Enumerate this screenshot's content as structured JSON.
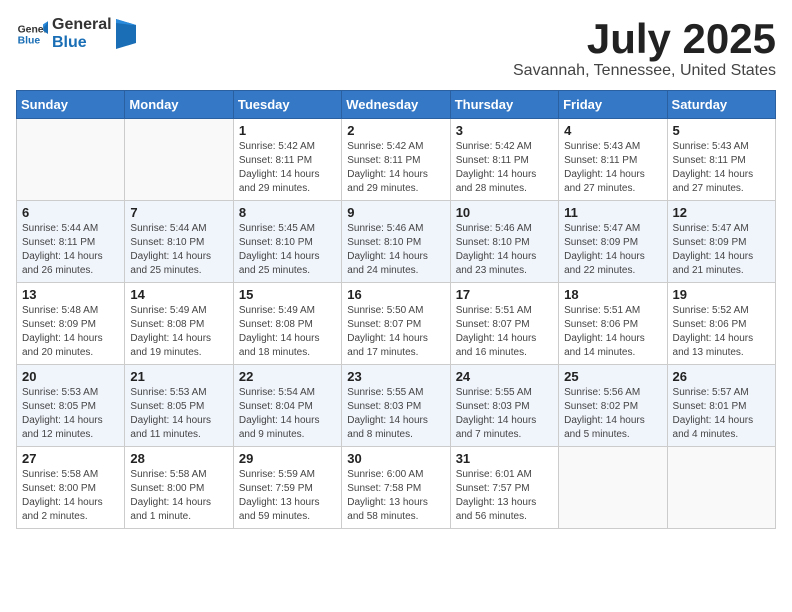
{
  "header": {
    "logo_general": "General",
    "logo_blue": "Blue",
    "month_title": "July 2025",
    "location": "Savannah, Tennessee, United States"
  },
  "days_of_week": [
    "Sunday",
    "Monday",
    "Tuesday",
    "Wednesday",
    "Thursday",
    "Friday",
    "Saturday"
  ],
  "weeks": [
    {
      "row_class": "row-white",
      "days": [
        {
          "num": "",
          "info": "",
          "empty": true
        },
        {
          "num": "",
          "info": "",
          "empty": true
        },
        {
          "num": "1",
          "info": "Sunrise: 5:42 AM\nSunset: 8:11 PM\nDaylight: 14 hours\nand 29 minutes."
        },
        {
          "num": "2",
          "info": "Sunrise: 5:42 AM\nSunset: 8:11 PM\nDaylight: 14 hours\nand 29 minutes."
        },
        {
          "num": "3",
          "info": "Sunrise: 5:42 AM\nSunset: 8:11 PM\nDaylight: 14 hours\nand 28 minutes."
        },
        {
          "num": "4",
          "info": "Sunrise: 5:43 AM\nSunset: 8:11 PM\nDaylight: 14 hours\nand 27 minutes."
        },
        {
          "num": "5",
          "info": "Sunrise: 5:43 AM\nSunset: 8:11 PM\nDaylight: 14 hours\nand 27 minutes."
        }
      ]
    },
    {
      "row_class": "row-blue",
      "days": [
        {
          "num": "6",
          "info": "Sunrise: 5:44 AM\nSunset: 8:11 PM\nDaylight: 14 hours\nand 26 minutes."
        },
        {
          "num": "7",
          "info": "Sunrise: 5:44 AM\nSunset: 8:10 PM\nDaylight: 14 hours\nand 25 minutes."
        },
        {
          "num": "8",
          "info": "Sunrise: 5:45 AM\nSunset: 8:10 PM\nDaylight: 14 hours\nand 25 minutes."
        },
        {
          "num": "9",
          "info": "Sunrise: 5:46 AM\nSunset: 8:10 PM\nDaylight: 14 hours\nand 24 minutes."
        },
        {
          "num": "10",
          "info": "Sunrise: 5:46 AM\nSunset: 8:10 PM\nDaylight: 14 hours\nand 23 minutes."
        },
        {
          "num": "11",
          "info": "Sunrise: 5:47 AM\nSunset: 8:09 PM\nDaylight: 14 hours\nand 22 minutes."
        },
        {
          "num": "12",
          "info": "Sunrise: 5:47 AM\nSunset: 8:09 PM\nDaylight: 14 hours\nand 21 minutes."
        }
      ]
    },
    {
      "row_class": "row-white",
      "days": [
        {
          "num": "13",
          "info": "Sunrise: 5:48 AM\nSunset: 8:09 PM\nDaylight: 14 hours\nand 20 minutes."
        },
        {
          "num": "14",
          "info": "Sunrise: 5:49 AM\nSunset: 8:08 PM\nDaylight: 14 hours\nand 19 minutes."
        },
        {
          "num": "15",
          "info": "Sunrise: 5:49 AM\nSunset: 8:08 PM\nDaylight: 14 hours\nand 18 minutes."
        },
        {
          "num": "16",
          "info": "Sunrise: 5:50 AM\nSunset: 8:07 PM\nDaylight: 14 hours\nand 17 minutes."
        },
        {
          "num": "17",
          "info": "Sunrise: 5:51 AM\nSunset: 8:07 PM\nDaylight: 14 hours\nand 16 minutes."
        },
        {
          "num": "18",
          "info": "Sunrise: 5:51 AM\nSunset: 8:06 PM\nDaylight: 14 hours\nand 14 minutes."
        },
        {
          "num": "19",
          "info": "Sunrise: 5:52 AM\nSunset: 8:06 PM\nDaylight: 14 hours\nand 13 minutes."
        }
      ]
    },
    {
      "row_class": "row-blue",
      "days": [
        {
          "num": "20",
          "info": "Sunrise: 5:53 AM\nSunset: 8:05 PM\nDaylight: 14 hours\nand 12 minutes."
        },
        {
          "num": "21",
          "info": "Sunrise: 5:53 AM\nSunset: 8:05 PM\nDaylight: 14 hours\nand 11 minutes."
        },
        {
          "num": "22",
          "info": "Sunrise: 5:54 AM\nSunset: 8:04 PM\nDaylight: 14 hours\nand 9 minutes."
        },
        {
          "num": "23",
          "info": "Sunrise: 5:55 AM\nSunset: 8:03 PM\nDaylight: 14 hours\nand 8 minutes."
        },
        {
          "num": "24",
          "info": "Sunrise: 5:55 AM\nSunset: 8:03 PM\nDaylight: 14 hours\nand 7 minutes."
        },
        {
          "num": "25",
          "info": "Sunrise: 5:56 AM\nSunset: 8:02 PM\nDaylight: 14 hours\nand 5 minutes."
        },
        {
          "num": "26",
          "info": "Sunrise: 5:57 AM\nSunset: 8:01 PM\nDaylight: 14 hours\nand 4 minutes."
        }
      ]
    },
    {
      "row_class": "row-white",
      "days": [
        {
          "num": "27",
          "info": "Sunrise: 5:58 AM\nSunset: 8:00 PM\nDaylight: 14 hours\nand 2 minutes."
        },
        {
          "num": "28",
          "info": "Sunrise: 5:58 AM\nSunset: 8:00 PM\nDaylight: 14 hours\nand 1 minute."
        },
        {
          "num": "29",
          "info": "Sunrise: 5:59 AM\nSunset: 7:59 PM\nDaylight: 13 hours\nand 59 minutes."
        },
        {
          "num": "30",
          "info": "Sunrise: 6:00 AM\nSunset: 7:58 PM\nDaylight: 13 hours\nand 58 minutes."
        },
        {
          "num": "31",
          "info": "Sunrise: 6:01 AM\nSunset: 7:57 PM\nDaylight: 13 hours\nand 56 minutes."
        },
        {
          "num": "",
          "info": "",
          "empty": true
        },
        {
          "num": "",
          "info": "",
          "empty": true
        }
      ]
    }
  ]
}
